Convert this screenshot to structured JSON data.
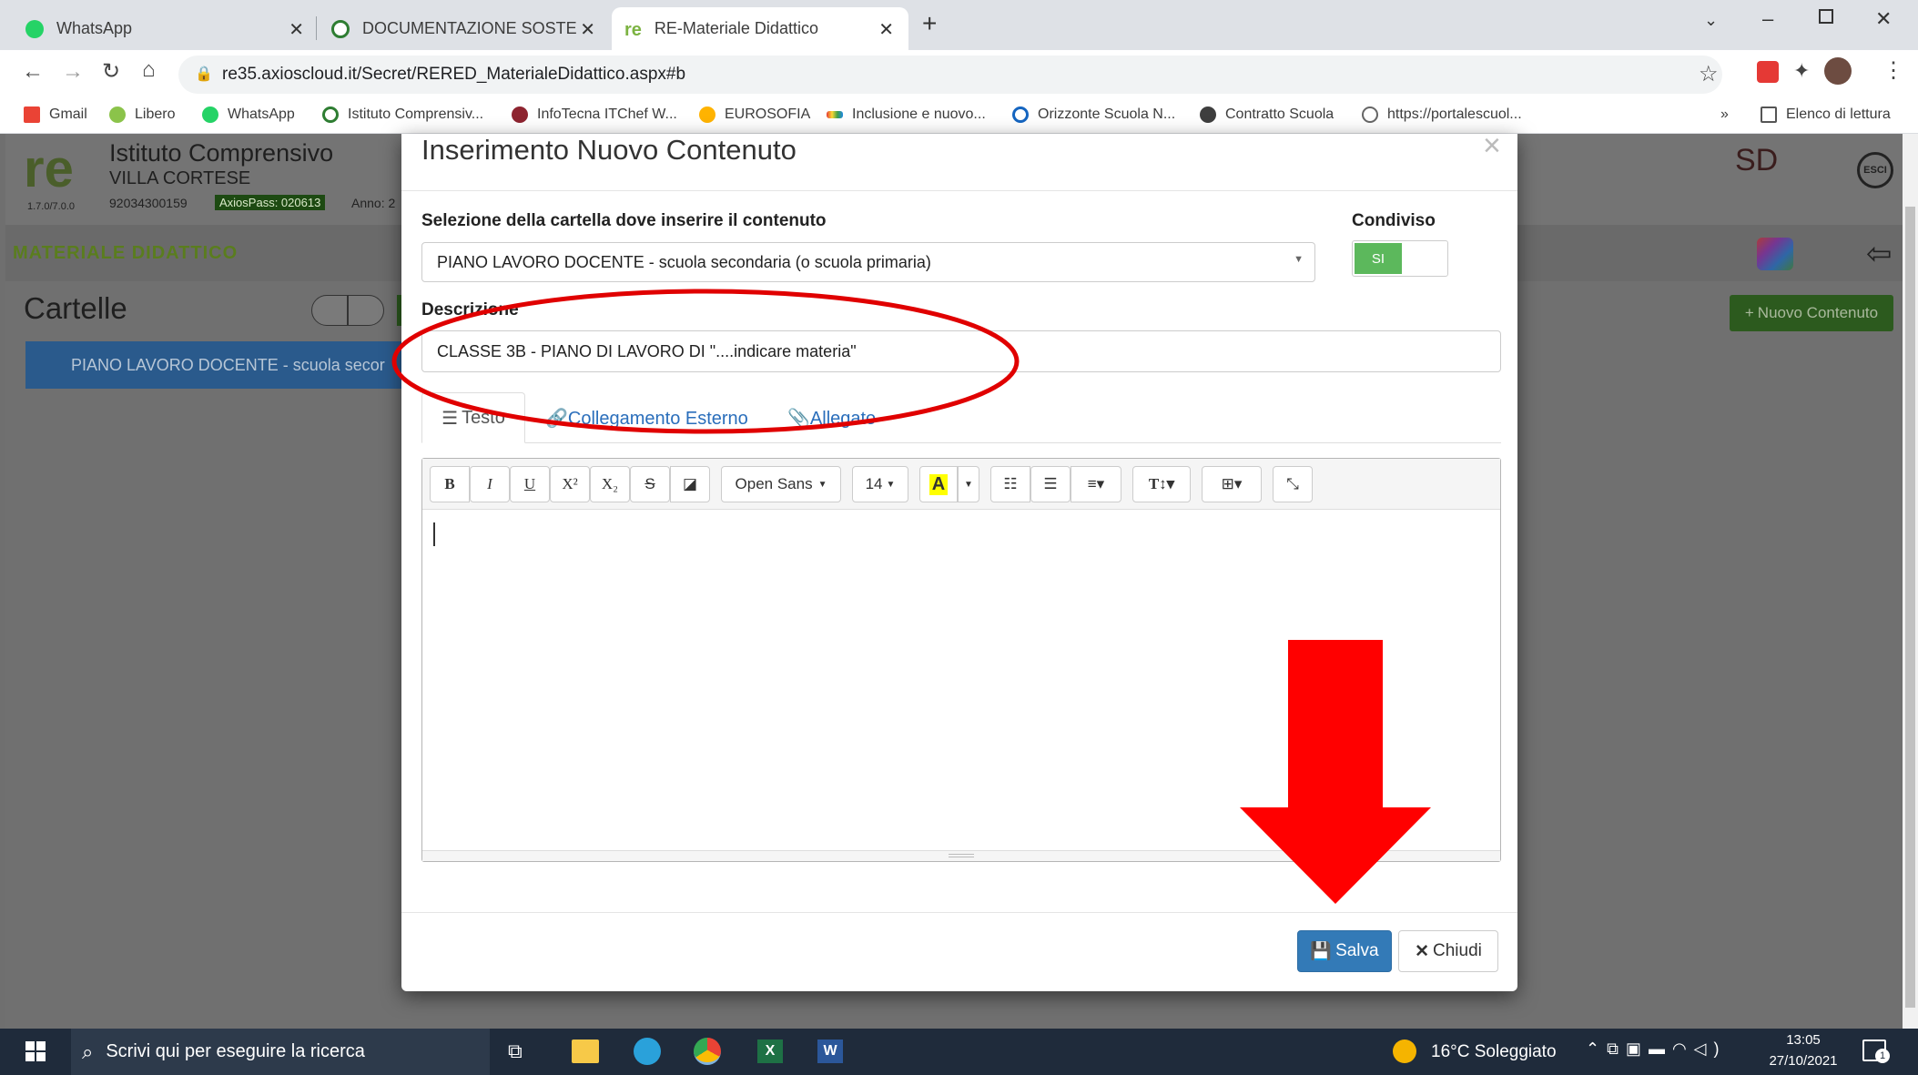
{
  "browser": {
    "tabs": [
      {
        "title": "WhatsApp"
      },
      {
        "title": "DOCUMENTAZIONE SOSTEGNO"
      },
      {
        "title": "RE-Materiale Didattico"
      }
    ],
    "url": "re35.axioscloud.it/Secret/RERED_MaterialeDidattico.aspx#b",
    "bookmarks": [
      "Gmail",
      "Libero",
      "WhatsApp",
      "Istituto Comprensiv...",
      "InfoTecna ITChef W...",
      "EUROSOFIA",
      "Inclusione e nuovo...",
      "Orizzonte Scuola N...",
      "Contratto Scuola",
      "https://portalescuol..."
    ],
    "more": "»",
    "reading_list": "Elenco di lettura"
  },
  "app": {
    "school_name": "Istituto Comprensivo",
    "school_place": "VILLA CORTESE",
    "version": "1.7.0/7.0.0",
    "code": "92034300159",
    "axios_pass": "AxiosPass: 020613",
    "anno": "Anno: 2",
    "section_title": "MATERIALE DIDATTICO",
    "cartelle_title": "Cartelle",
    "folder_item": "PIANO LAVORO DOCENTE - scuola secor",
    "nuovo_contenuto": "Nuovo Contenuto",
    "sd_logo": "SD",
    "esci": "ESCI"
  },
  "modal": {
    "title": "Inserimento Nuovo Contenuto",
    "close_glyph": "×",
    "folder_label": "Selezione della cartella dove inserire il contenuto",
    "folder_value": "PIANO LAVORO DOCENTE - scuola secondaria (o scuola primaria)",
    "shared_label": "Condiviso",
    "shared_value": "SI",
    "description_label": "Descrizione",
    "description_value": "CLASSE 3B - PIANO DI LAVORO DI \"....indicare materia\"",
    "tabs": [
      {
        "label": "Testo",
        "active": true
      },
      {
        "label": "Collegamento Esterno",
        "active": false
      },
      {
        "label": "Allegato",
        "active": false
      }
    ],
    "editor_font": "Open Sans",
    "editor_size": "14",
    "save_label": "Salva",
    "close_label": "Chiudi"
  },
  "taskbar": {
    "search_placeholder": "Scrivi qui per eseguire la ricerca",
    "weather": "16°C Soleggiato",
    "time": "13:05",
    "date": "27/10/2021",
    "notifications": "1"
  },
  "colors": {
    "annotation_red": "#e00000",
    "toggle_green": "#5cb85c",
    "primary_blue": "#337ab7",
    "folder_blue": "#2a5a8c",
    "link_blue": "#2a6ebb",
    "section_green": "#5a7d1e"
  }
}
